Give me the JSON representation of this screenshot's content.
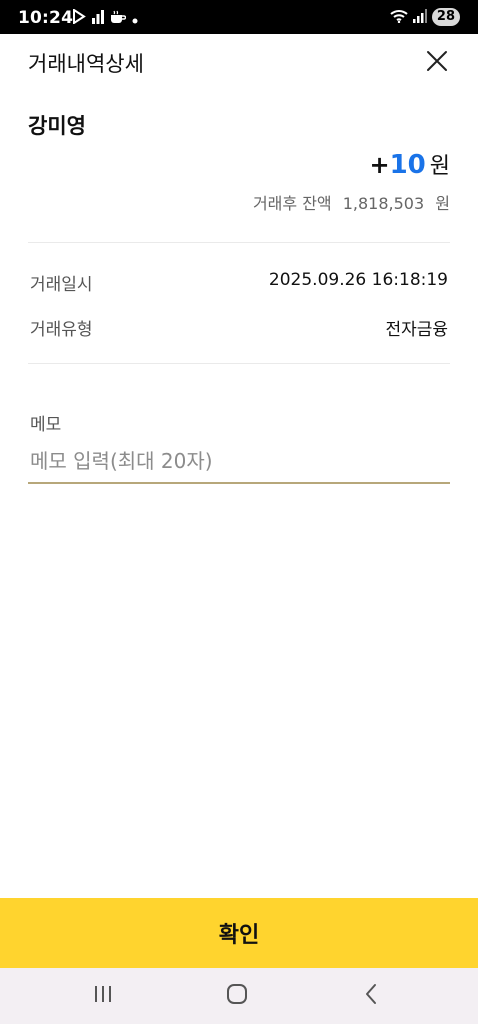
{
  "status_bar": {
    "time": "10:24",
    "battery": "28"
  },
  "header": {
    "title": "거래내역상세"
  },
  "account": {
    "name": "강미영",
    "amount_sign": "+",
    "amount_value": "10",
    "amount_unit": "원",
    "amount_color": "#1a73e8",
    "balance_label": "거래후 잔액",
    "balance_value": "1,818,503",
    "balance_unit": "원"
  },
  "details": [
    {
      "label": "거래일시",
      "value": "2025.09.26 16:18:19"
    },
    {
      "label": "거래유형",
      "value": "전자금융"
    }
  ],
  "memo": {
    "label": "메모",
    "placeholder": "메모 입력(최대 20자)",
    "value": ""
  },
  "confirm_button": {
    "label": "확인",
    "color": "#ffd42e"
  },
  "icons": {
    "close": "close-icon",
    "nav_recent": "recent-apps-icon",
    "nav_home": "home-icon",
    "nav_back": "back-icon"
  }
}
